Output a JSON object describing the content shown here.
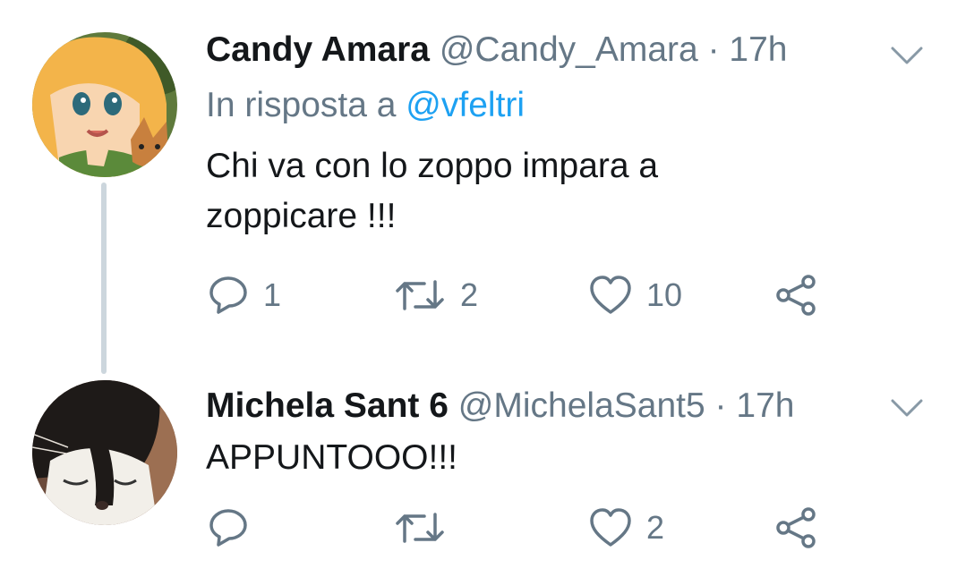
{
  "tweets": [
    {
      "name": "Candy Amara",
      "handle": "@Candy_Amara",
      "separator": "·",
      "time": "17h",
      "reply_prefix": "In risposta a",
      "reply_handle": "@vfeltri",
      "text": "Chi va con lo zoppo impara a zoppicare !!!",
      "avatar_icon": "cartoon-girl-with-cat-avatar",
      "reply_count": "1",
      "retweet_count": "2",
      "like_count": "10"
    },
    {
      "name": "Michela Sant 6",
      "handle": "@MichelaSant5",
      "separator": "·",
      "time": "17h",
      "text": "APPUNTOOO!!!",
      "avatar_icon": "cat-photo-avatar",
      "reply_count": "",
      "retweet_count": "",
      "like_count": "2"
    }
  ],
  "colors": {
    "text": "#14171a",
    "secondary": "#657786",
    "link": "#1da1f2",
    "thread_line": "#ccd6dd"
  },
  "icons": [
    "reply-icon",
    "retweet-icon",
    "like-icon",
    "share-icon",
    "chevron-down-icon"
  ]
}
